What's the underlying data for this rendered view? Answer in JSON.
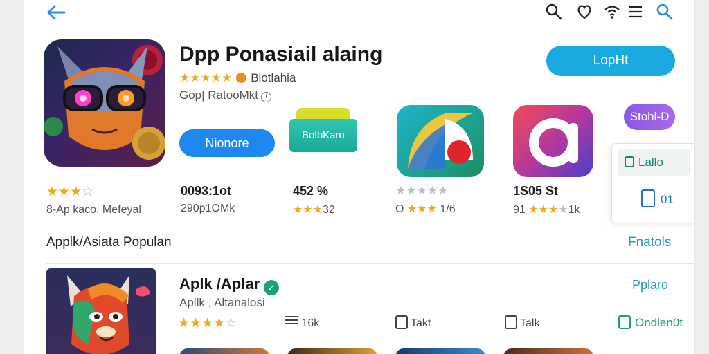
{
  "header": {
    "icons": [
      "back-arrow-icon",
      "search-icon",
      "heart-icon",
      "wifi-icon",
      "menu-icon",
      "search-icon"
    ]
  },
  "app": {
    "title": "Dpp Ponasiail alaing",
    "rating_label": "Biotlahia",
    "developer": "Gop| RatooMkt",
    "install_label": "LopHt",
    "secondary_label": "Nionore",
    "purple_label": "Stohl-D"
  },
  "tiles": {
    "green_label": "BolbKaro"
  },
  "side_card": {
    "item1": "Lallo",
    "item2": "01"
  },
  "stats": [
    {
      "value": "0093:1ot",
      "sub_text": "8-Ap kaco. Mefeyal",
      "stars_filled": 3,
      "stars_total": 4
    },
    {
      "value": "",
      "sub_text": "290p1OMk",
      "stars_filled": 0,
      "stars_total": 0
    },
    {
      "value": "452 %",
      "sub_text": "32",
      "stars_filled": 3,
      "stars_total": 3
    },
    {
      "value": "",
      "sub_text": "O",
      "sub_after": "1/6",
      "stars_filled": 3,
      "stars_total": 3
    },
    {
      "value": "1S05 St",
      "sub_text": "91",
      "sub_after": "1k",
      "stars_filled": 3,
      "stars_total": 4
    }
  ],
  "section": {
    "title": "Applk/Asiata Populan",
    "link": "Fnatols"
  },
  "list_item": {
    "title": "Aplk /Aplar",
    "subtitle": "Apllk , Altanalosi",
    "stars_filled": 4,
    "stars_total": 5,
    "meta1": "16k",
    "meta2": "Takt",
    "meta3": "Talk",
    "link": "Pplaro",
    "action": "Ondlen0t"
  },
  "colors": {
    "accent_blue": "#1ba9e1",
    "button_blue": "#1e88f0",
    "link_blue": "#2496d8",
    "star_gold": "#f2a81d",
    "green": "#1aa36b",
    "purple": "#8b55e8"
  }
}
